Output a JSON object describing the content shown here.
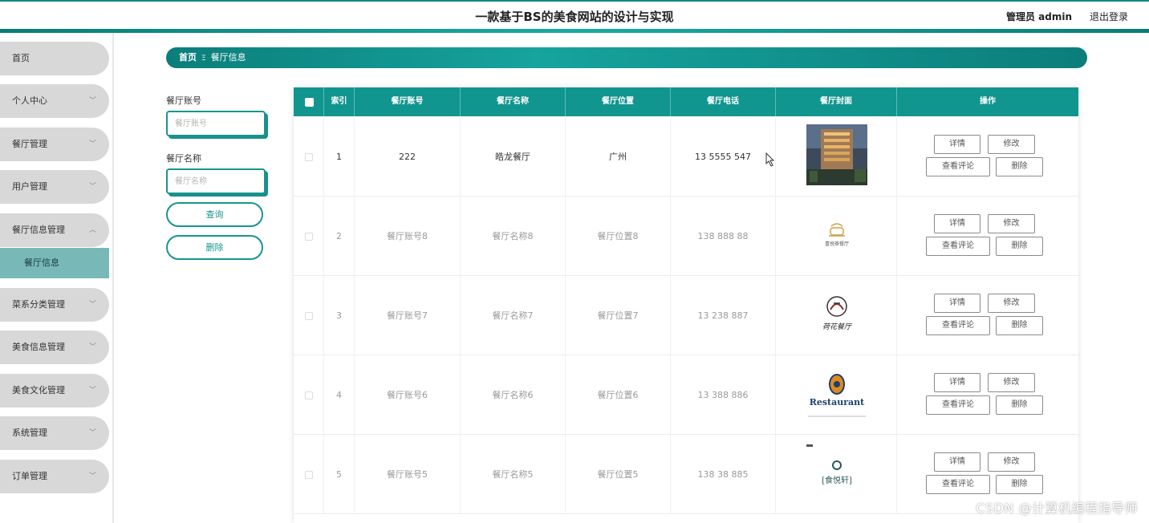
{
  "header": {
    "title": "一款基于BS的美食网站的设计与实现",
    "user": "管理员 admin",
    "logout": "退出登录"
  },
  "sidebar": {
    "items": [
      {
        "label": "首页",
        "has_arrow": false
      },
      {
        "label": "个人中心",
        "has_arrow": true
      },
      {
        "label": "餐厅管理",
        "has_arrow": true
      },
      {
        "label": "用户管理",
        "has_arrow": true
      },
      {
        "label": "餐厅信息管理",
        "has_arrow": true,
        "expanded": true
      },
      {
        "label": "菜系分类管理",
        "has_arrow": true
      },
      {
        "label": "美食信息管理",
        "has_arrow": true
      },
      {
        "label": "美食文化管理",
        "has_arrow": true
      },
      {
        "label": "系统管理",
        "has_arrow": true
      },
      {
        "label": "订单管理",
        "has_arrow": true
      }
    ],
    "active_sub": "餐厅信息"
  },
  "breadcrumb": {
    "home": "首页",
    "current": "餐厅信息"
  },
  "search": {
    "account_label": "餐厅账号",
    "account_placeholder": "餐厅账号",
    "name_label": "餐厅名称",
    "name_placeholder": "餐厅名称",
    "query_button": "查询",
    "delete_button": "删除"
  },
  "table": {
    "headers": [
      "索引",
      "餐厅账号",
      "餐厅名称",
      "餐厅位置",
      "餐厅电话",
      "餐厅封面",
      "操作"
    ],
    "rows": [
      {
        "index": "1",
        "account": "222",
        "name": "皓龙餐厅",
        "location": "广州",
        "phone": "13 5555 547",
        "cover": "hotel-photo"
      },
      {
        "index": "2",
        "account": "餐厅账号8",
        "name": "餐厅名称8",
        "location": "餐厅位置8",
        "phone": "138 888 88",
        "cover": "cup-logo"
      },
      {
        "index": "3",
        "account": "餐厅账号7",
        "name": "餐厅名称7",
        "location": "餐厅位置7",
        "phone": "13 238 887",
        "cover": "lotus-logo"
      },
      {
        "index": "4",
        "account": "餐厅账号6",
        "name": "餐厅名称6",
        "location": "餐厅位置6",
        "phone": "13 388 886",
        "cover": "restaurant-badge-logo"
      },
      {
        "index": "5",
        "account": "餐厅账号5",
        "name": "餐厅名称5",
        "location": "餐厅位置5",
        "phone": "138 38 885",
        "cover": "calligraphy-logo"
      }
    ],
    "actions": {
      "detail": "详情",
      "edit": "修改",
      "comments": "查看评论",
      "delete": "删除"
    },
    "cover_texts": {
      "cup_logo_text": "喜悦茶餐厅",
      "lotus_logo_text": "荷花餐厅",
      "restaurant_logo_text": "Restaurant",
      "calligraphy_logo_text": "[食悦轩]"
    }
  },
  "watermark": "CSDN @计算机编程指导师",
  "colors": {
    "accent": "#11958f",
    "sidebar_item": "#d8d8d8",
    "sidebar_active": "#78b9b8"
  }
}
